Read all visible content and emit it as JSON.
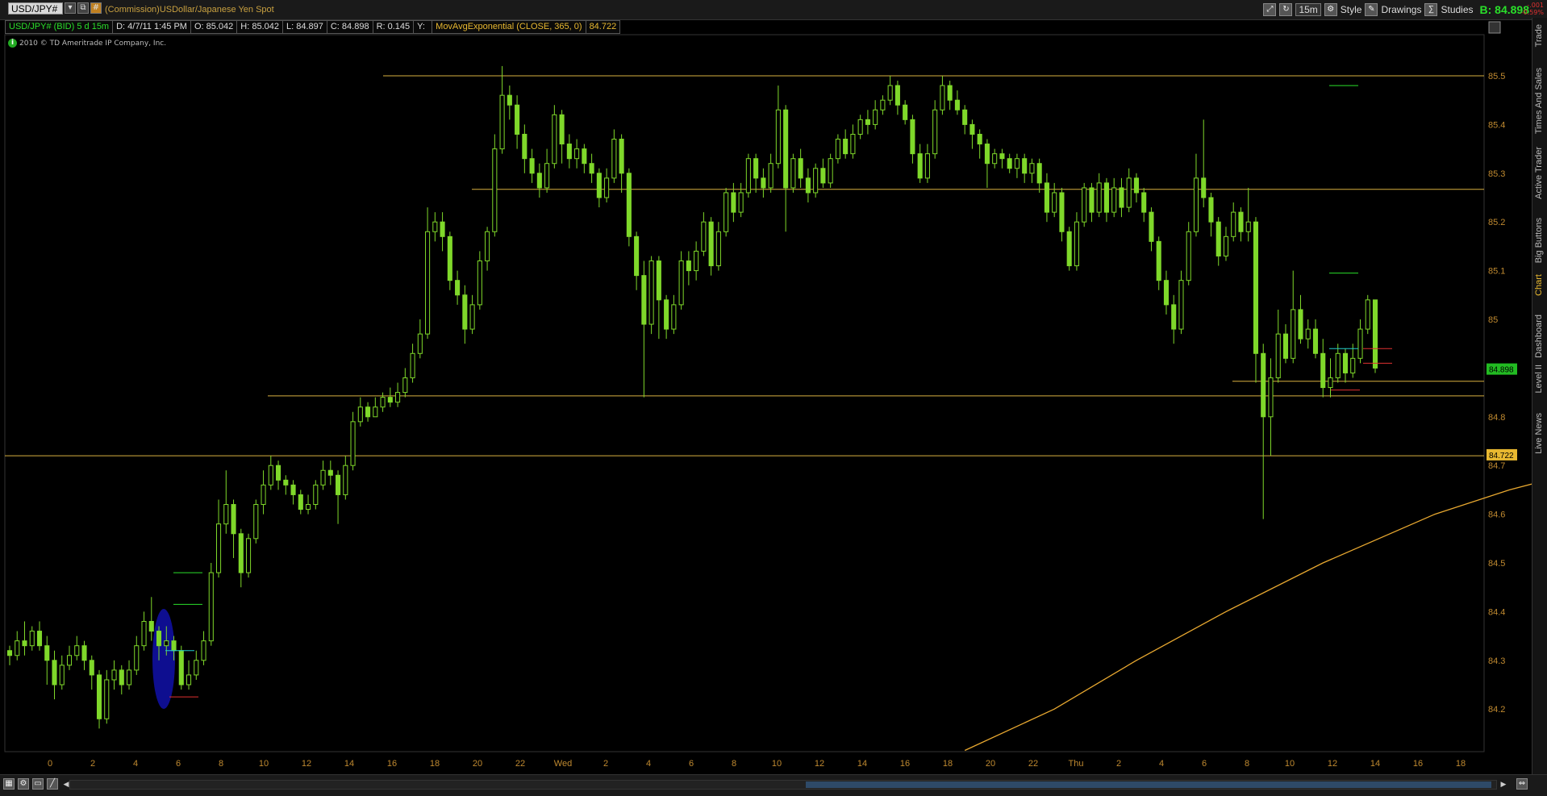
{
  "header": {
    "symbol": "USD/JPY#",
    "description": "(Commission)USDollar/Japanese Yen Spot",
    "timeframe": "15m",
    "style_label": "Style",
    "drawings_label": "Drawings",
    "studies_label": "Studies",
    "bid_label": "B: 84.898",
    "change_top": "-.001",
    "change_bottom": "-0.59%"
  },
  "infobar": {
    "symbol_period": "USD/JPY# (BID) 5 d 15m",
    "date": "D: 4/7/11 1:45 PM",
    "open": "O: 85.042",
    "high": "H: 85.042",
    "low": "L: 84.897",
    "close": "C: 84.898",
    "range": "R: 0.145",
    "y": "Y:",
    "study": "MovAvgExponential (CLOSE, 365, 0)",
    "study_value": "84.722"
  },
  "copyright": "2010 © TD Ameritrade IP Company, Inc.",
  "sidebar": {
    "tabs": [
      "Trade",
      "Times And Sales",
      "Active Trader",
      "Big Buttons",
      "Chart",
      "Dashboard",
      "Level II",
      "Live News"
    ],
    "active": "Chart"
  },
  "chart_data": {
    "type": "candlestick",
    "y_ticks": [
      "85.5",
      "85.4",
      "85.3",
      "85.2",
      "85.1",
      "85",
      "84.9",
      "84.8",
      "84.7",
      "84.6",
      "84.5",
      "84.4",
      "84.3",
      "84.2"
    ],
    "ylim": [
      84.115,
      85.545
    ],
    "x_ticks": [
      "0",
      "2",
      "4",
      "6",
      "8",
      "10",
      "12",
      "14",
      "16",
      "18",
      "20",
      "22",
      "Wed",
      "2",
      "4",
      "6",
      "8",
      "10",
      "12",
      "14",
      "16",
      "18",
      "20",
      "22",
      "Thu",
      "2",
      "4",
      "6",
      "8",
      "10",
      "12",
      "14",
      "16",
      "18"
    ],
    "price_label": "84.898",
    "ma_label": "84.722",
    "horizontal_lines": [
      85.5,
      85.267,
      84.843,
      84.72,
      84.873
    ],
    "candles": [
      [
        84.32,
        84.31,
        84.33,
        84.29
      ],
      [
        84.31,
        84.34,
        84.36,
        84.3
      ],
      [
        84.34,
        84.33,
        84.38,
        84.31
      ],
      [
        84.33,
        84.36,
        84.37,
        84.32
      ],
      [
        84.36,
        84.33,
        84.38,
        84.32
      ],
      [
        84.33,
        84.3,
        84.35,
        84.25
      ],
      [
        84.3,
        84.25,
        84.32,
        84.22
      ],
      [
        84.25,
        84.29,
        84.31,
        84.24
      ],
      [
        84.29,
        84.31,
        84.33,
        84.28
      ],
      [
        84.31,
        84.33,
        84.35,
        84.3
      ],
      [
        84.33,
        84.3,
        84.34,
        84.28
      ],
      [
        84.3,
        84.27,
        84.31,
        84.24
      ],
      [
        84.27,
        84.18,
        84.28,
        84.16
      ],
      [
        84.18,
        84.26,
        84.28,
        84.17
      ],
      [
        84.26,
        84.28,
        84.3,
        84.24
      ],
      [
        84.28,
        84.25,
        84.29,
        84.23
      ],
      [
        84.25,
        84.28,
        84.3,
        84.24
      ],
      [
        84.28,
        84.33,
        84.35,
        84.27
      ],
      [
        84.33,
        84.38,
        84.4,
        84.32
      ],
      [
        84.38,
        84.36,
        84.43,
        84.34
      ],
      [
        84.36,
        84.33,
        84.37,
        84.3
      ],
      [
        84.33,
        84.34,
        84.37,
        84.31
      ],
      [
        84.34,
        84.32,
        84.35,
        84.3
      ],
      [
        84.32,
        84.25,
        84.33,
        84.24
      ],
      [
        84.25,
        84.27,
        84.3,
        84.24
      ],
      [
        84.27,
        84.3,
        84.32,
        84.26
      ],
      [
        84.3,
        84.34,
        84.36,
        84.29
      ],
      [
        84.34,
        84.48,
        84.5,
        84.33
      ],
      [
        84.48,
        84.58,
        84.63,
        84.47
      ],
      [
        84.58,
        84.62,
        84.69,
        84.56
      ],
      [
        84.62,
        84.56,
        84.63,
        84.51
      ],
      [
        84.56,
        84.48,
        84.57,
        84.45
      ],
      [
        84.48,
        84.55,
        84.56,
        84.47
      ],
      [
        84.55,
        84.62,
        84.63,
        84.54
      ],
      [
        84.62,
        84.66,
        84.69,
        84.6
      ],
      [
        84.66,
        84.7,
        84.72,
        84.65
      ],
      [
        84.7,
        84.67,
        84.71,
        84.65
      ],
      [
        84.67,
        84.66,
        84.68,
        84.64
      ],
      [
        84.66,
        84.64,
        84.67,
        84.62
      ],
      [
        84.64,
        84.61,
        84.65,
        84.6
      ],
      [
        84.61,
        84.62,
        84.64,
        84.6
      ],
      [
        84.62,
        84.66,
        84.67,
        84.61
      ],
      [
        84.66,
        84.69,
        84.71,
        84.65
      ],
      [
        84.69,
        84.68,
        84.71,
        84.66
      ],
      [
        84.68,
        84.64,
        84.69,
        84.58
      ],
      [
        84.64,
        84.7,
        84.72,
        84.63
      ],
      [
        84.7,
        84.79,
        84.81,
        84.69
      ],
      [
        84.79,
        84.82,
        84.84,
        84.78
      ],
      [
        84.82,
        84.8,
        84.83,
        84.79
      ],
      [
        84.8,
        84.82,
        84.84,
        84.8
      ],
      [
        84.82,
        84.84,
        84.85,
        84.81
      ],
      [
        84.84,
        84.83,
        84.86,
        84.82
      ],
      [
        84.83,
        84.85,
        84.87,
        84.82
      ],
      [
        84.85,
        84.88,
        84.9,
        84.84
      ],
      [
        84.88,
        84.93,
        84.95,
        84.87
      ],
      [
        84.93,
        84.97,
        85.0,
        84.92
      ],
      [
        84.97,
        85.18,
        85.23,
        84.96
      ],
      [
        85.18,
        85.2,
        85.22,
        85.16
      ],
      [
        85.2,
        85.17,
        85.22,
        85.14
      ],
      [
        85.17,
        85.08,
        85.18,
        85.06
      ],
      [
        85.08,
        85.05,
        85.1,
        85.03
      ],
      [
        85.05,
        84.98,
        85.07,
        84.95
      ],
      [
        84.98,
        85.03,
        85.05,
        84.97
      ],
      [
        85.03,
        85.12,
        85.14,
        85.02
      ],
      [
        85.12,
        85.18,
        85.19,
        85.1
      ],
      [
        85.18,
        85.35,
        85.38,
        85.17
      ],
      [
        85.35,
        85.46,
        85.52,
        85.34
      ],
      [
        85.46,
        85.44,
        85.48,
        85.41
      ],
      [
        85.44,
        85.38,
        85.46,
        85.35
      ],
      [
        85.38,
        85.33,
        85.4,
        85.3
      ],
      [
        85.33,
        85.3,
        85.35,
        85.28
      ],
      [
        85.3,
        85.27,
        85.32,
        85.25
      ],
      [
        85.27,
        85.32,
        85.35,
        85.26
      ],
      [
        85.32,
        85.42,
        85.44,
        85.31
      ],
      [
        85.42,
        85.36,
        85.43,
        85.32
      ],
      [
        85.36,
        85.33,
        85.38,
        85.31
      ],
      [
        85.33,
        85.35,
        85.37,
        85.31
      ],
      [
        85.35,
        85.32,
        85.36,
        85.3
      ],
      [
        85.32,
        85.3,
        85.34,
        85.28
      ],
      [
        85.3,
        85.25,
        85.31,
        85.23
      ],
      [
        85.25,
        85.29,
        85.31,
        85.24
      ],
      [
        85.29,
        85.37,
        85.39,
        85.28
      ],
      [
        85.37,
        85.3,
        85.38,
        85.26
      ],
      [
        85.3,
        85.17,
        85.31,
        85.15
      ],
      [
        85.17,
        85.09,
        85.18,
        85.06
      ],
      [
        85.09,
        84.99,
        85.12,
        84.84
      ],
      [
        84.99,
        85.12,
        85.13,
        84.97
      ],
      [
        85.12,
        85.04,
        85.13,
        84.96
      ],
      [
        85.04,
        84.98,
        85.05,
        84.96
      ],
      [
        84.98,
        85.03,
        85.05,
        84.97
      ],
      [
        85.03,
        85.12,
        85.14,
        85.02
      ],
      [
        85.12,
        85.1,
        85.14,
        85.07
      ],
      [
        85.1,
        85.14,
        85.16,
        85.08
      ],
      [
        85.14,
        85.2,
        85.22,
        85.13
      ],
      [
        85.2,
        85.11,
        85.21,
        85.09
      ],
      [
        85.11,
        85.18,
        85.2,
        85.1
      ],
      [
        85.18,
        85.26,
        85.27,
        85.17
      ],
      [
        85.26,
        85.22,
        85.28,
        85.2
      ],
      [
        85.22,
        85.26,
        85.28,
        85.21
      ],
      [
        85.26,
        85.33,
        85.34,
        85.25
      ],
      [
        85.33,
        85.29,
        85.34,
        85.26
      ],
      [
        85.29,
        85.27,
        85.31,
        85.25
      ],
      [
        85.27,
        85.32,
        85.34,
        85.26
      ],
      [
        85.32,
        85.43,
        85.48,
        85.31
      ],
      [
        85.43,
        85.27,
        85.44,
        85.18
      ],
      [
        85.27,
        85.33,
        85.34,
        85.26
      ],
      [
        85.33,
        85.29,
        85.35,
        85.27
      ],
      [
        85.29,
        85.26,
        85.31,
        85.24
      ],
      [
        85.26,
        85.31,
        85.32,
        85.25
      ],
      [
        85.31,
        85.28,
        85.33,
        85.27
      ],
      [
        85.28,
        85.33,
        85.34,
        85.27
      ],
      [
        85.33,
        85.37,
        85.38,
        85.32
      ],
      [
        85.37,
        85.34,
        85.39,
        85.33
      ],
      [
        85.34,
        85.38,
        85.4,
        85.33
      ],
      [
        85.38,
        85.41,
        85.42,
        85.37
      ],
      [
        85.41,
        85.4,
        85.43,
        85.38
      ],
      [
        85.4,
        85.43,
        85.45,
        85.39
      ],
      [
        85.43,
        85.45,
        85.46,
        85.42
      ],
      [
        85.45,
        85.48,
        85.5,
        85.44
      ],
      [
        85.48,
        85.44,
        85.49,
        85.42
      ],
      [
        85.44,
        85.41,
        85.45,
        85.4
      ],
      [
        85.41,
        85.34,
        85.42,
        85.32
      ],
      [
        85.34,
        85.29,
        85.36,
        85.28
      ],
      [
        85.29,
        85.34,
        85.36,
        85.28
      ],
      [
        85.34,
        85.43,
        85.45,
        85.33
      ],
      [
        85.43,
        85.48,
        85.5,
        85.42
      ],
      [
        85.48,
        85.45,
        85.49,
        85.43
      ],
      [
        85.45,
        85.43,
        85.47,
        85.42
      ],
      [
        85.43,
        85.4,
        85.44,
        85.38
      ],
      [
        85.4,
        85.38,
        85.41,
        85.35
      ],
      [
        85.38,
        85.36,
        85.39,
        85.33
      ],
      [
        85.36,
        85.32,
        85.37,
        85.27
      ],
      [
        85.32,
        85.34,
        85.35,
        85.31
      ],
      [
        85.34,
        85.33,
        85.35,
        85.31
      ],
      [
        85.33,
        85.31,
        85.34,
        85.3
      ],
      [
        85.31,
        85.33,
        85.34,
        85.29
      ],
      [
        85.33,
        85.3,
        85.34,
        85.28
      ],
      [
        85.3,
        85.32,
        85.33,
        85.28
      ],
      [
        85.32,
        85.28,
        85.33,
        85.26
      ],
      [
        85.28,
        85.22,
        85.3,
        85.2
      ],
      [
        85.22,
        85.26,
        85.28,
        85.21
      ],
      [
        85.26,
        85.18,
        85.27,
        85.16
      ],
      [
        85.18,
        85.11,
        85.19,
        85.1
      ],
      [
        85.11,
        85.2,
        85.22,
        85.1
      ],
      [
        85.2,
        85.27,
        85.28,
        85.19
      ],
      [
        85.27,
        85.22,
        85.28,
        85.2
      ],
      [
        85.22,
        85.28,
        85.3,
        85.21
      ],
      [
        85.28,
        85.22,
        85.29,
        85.2
      ],
      [
        85.22,
        85.27,
        85.29,
        85.21
      ],
      [
        85.27,
        85.23,
        85.29,
        85.21
      ],
      [
        85.23,
        85.29,
        85.31,
        85.22
      ],
      [
        85.29,
        85.26,
        85.3,
        85.24
      ],
      [
        85.26,
        85.22,
        85.27,
        85.2
      ],
      [
        85.22,
        85.16,
        85.23,
        85.14
      ],
      [
        85.16,
        85.08,
        85.17,
        85.06
      ],
      [
        85.08,
        85.03,
        85.1,
        85.01
      ],
      [
        85.03,
        84.98,
        85.05,
        84.95
      ],
      [
        84.98,
        85.08,
        85.1,
        84.97
      ],
      [
        85.08,
        85.18,
        85.2,
        85.07
      ],
      [
        85.18,
        85.29,
        85.34,
        85.17
      ],
      [
        85.29,
        85.25,
        85.41,
        85.23
      ],
      [
        85.25,
        85.2,
        85.26,
        85.17
      ],
      [
        85.2,
        85.13,
        85.21,
        85.11
      ],
      [
        85.13,
        85.17,
        85.19,
        85.12
      ],
      [
        85.17,
        85.22,
        85.24,
        85.16
      ],
      [
        85.22,
        85.18,
        85.23,
        85.16
      ],
      [
        85.18,
        85.2,
        85.27,
        85.16
      ],
      [
        85.2,
        84.93,
        85.21,
        84.87
      ],
      [
        84.93,
        84.8,
        84.95,
        84.59
      ],
      [
        84.8,
        84.88,
        84.92,
        84.72
      ],
      [
        84.88,
        84.97,
        85.02,
        84.87
      ],
      [
        84.97,
        84.92,
        84.99,
        84.91
      ],
      [
        84.92,
        85.02,
        85.1,
        84.91
      ],
      [
        85.02,
        84.96,
        85.05,
        84.95
      ],
      [
        84.96,
        84.98,
        85.0,
        84.94
      ],
      [
        84.98,
        84.93,
        85.0,
        84.92
      ],
      [
        84.93,
        84.86,
        84.96,
        84.84
      ],
      [
        84.86,
        84.88,
        84.92,
        84.84
      ],
      [
        84.88,
        84.93,
        84.95,
        84.87
      ],
      [
        84.93,
        84.89,
        84.94,
        84.87
      ],
      [
        84.89,
        84.92,
        84.95,
        84.88
      ],
      [
        84.92,
        84.98,
        85.0,
        84.91
      ],
      [
        84.98,
        85.04,
        85.05,
        84.97
      ],
      [
        85.04,
        84.9,
        85.04,
        84.89
      ]
    ],
    "ema_points": [
      [
        84.115,
        128
      ],
      [
        84.2,
        140
      ],
      [
        84.3,
        151
      ],
      [
        84.4,
        163
      ],
      [
        84.5,
        176
      ],
      [
        84.6,
        191
      ],
      [
        84.65,
        201
      ],
      [
        84.69,
        211
      ],
      [
        84.713,
        219
      ],
      [
        84.722,
        228
      ]
    ]
  }
}
